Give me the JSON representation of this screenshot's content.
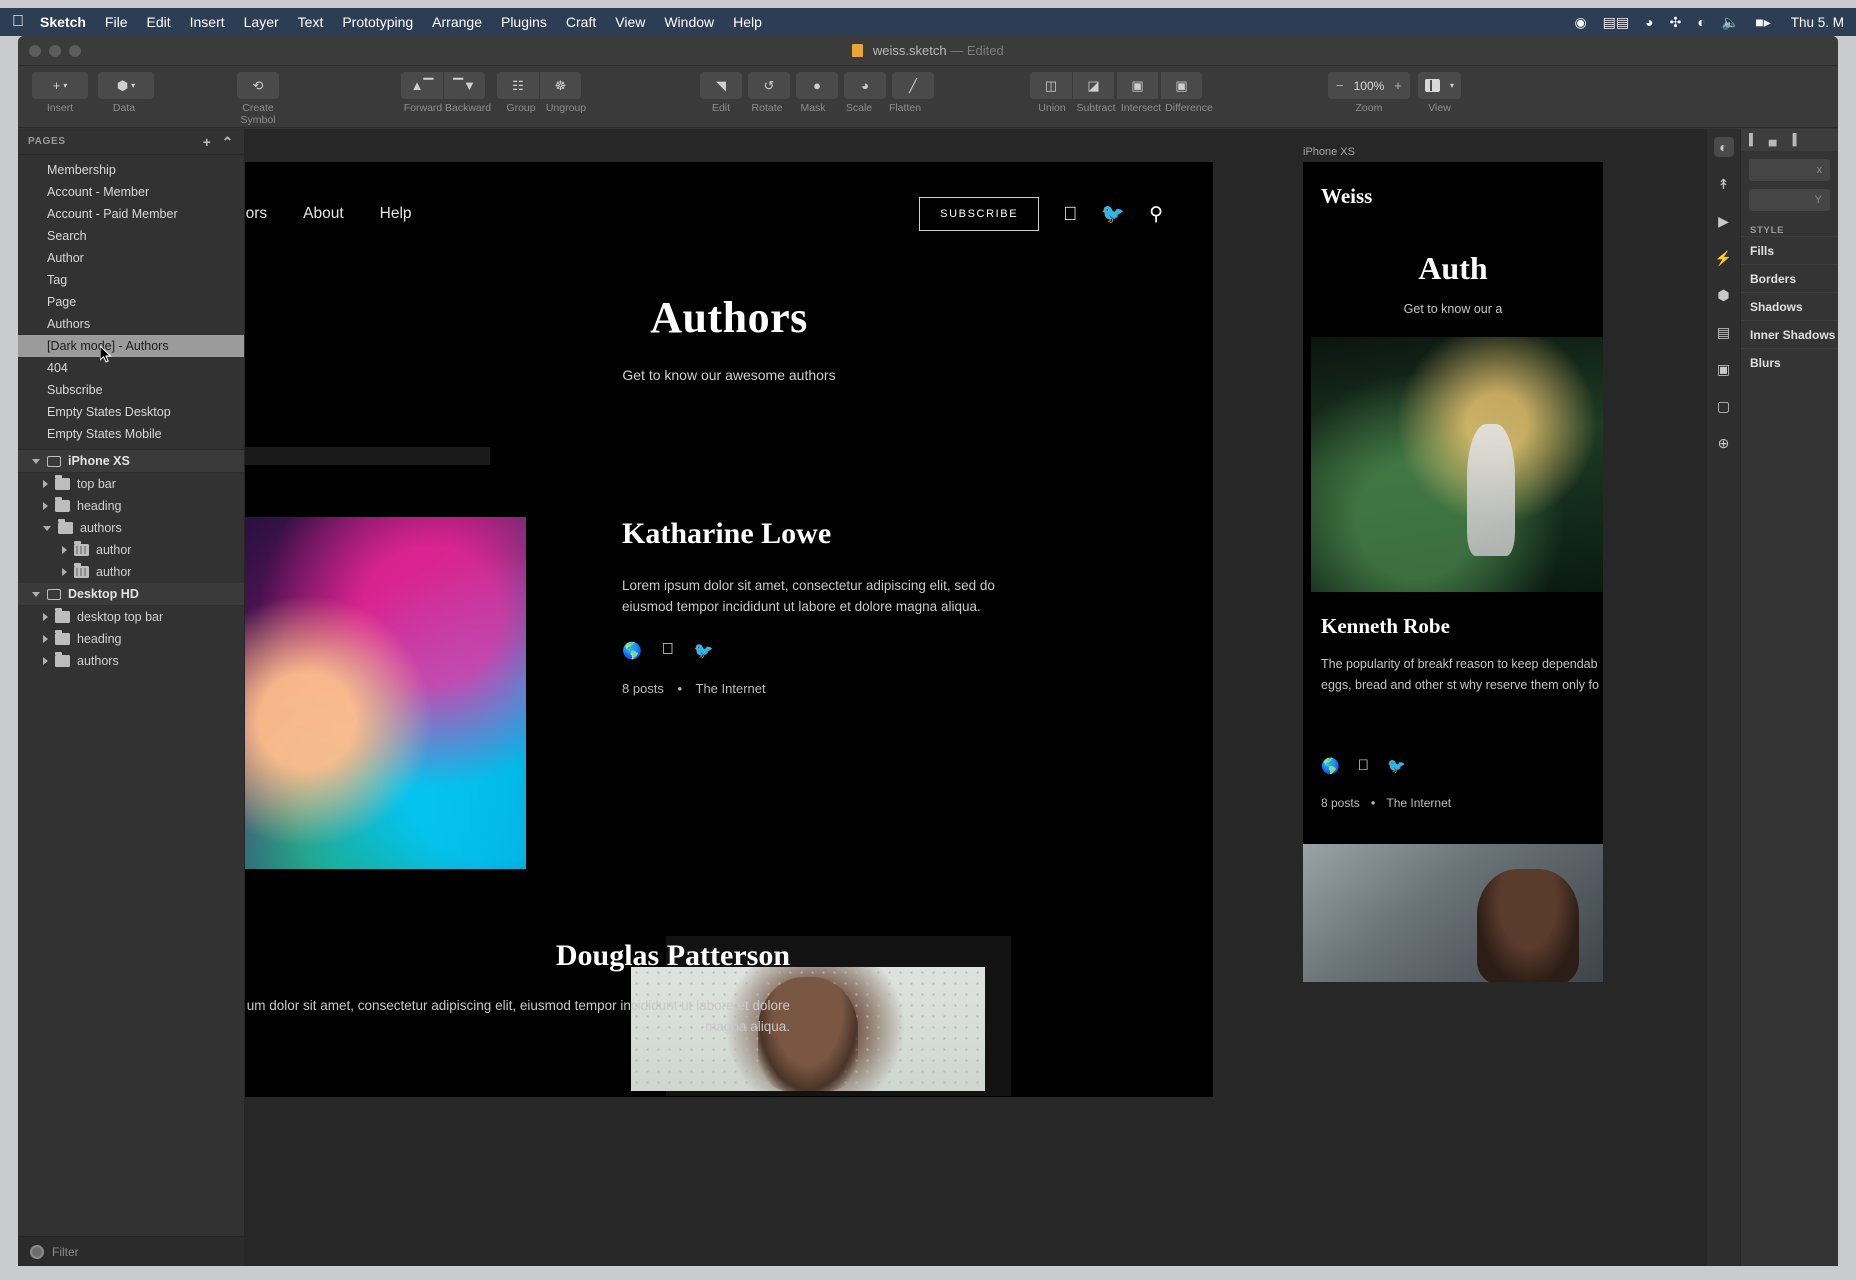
{
  "menubar": {
    "apple_icon": "apple-icon",
    "items": [
      "Sketch",
      "File",
      "Edit",
      "Insert",
      "Layer",
      "Text",
      "Prototyping",
      "Arrange",
      "Plugins",
      "Craft",
      "View",
      "Window",
      "Help"
    ],
    "status_icons": [
      "record-icon",
      "screen-share-icon",
      "clock-icon",
      "dropbox-icon",
      "wifi-icon",
      "volume-icon",
      "battery-icon"
    ],
    "clock": "Thu 5. M"
  },
  "titlebar": {
    "document": "weiss.sketch",
    "state": "— Edited"
  },
  "toolbar": {
    "insert_label": "Insert",
    "data_label": "Data",
    "create_symbol_label": "Create Symbol",
    "forward_label": "Forward",
    "backward_label": "Backward",
    "group_label": "Group",
    "ungroup_label": "Ungroup",
    "edit_label": "Edit",
    "rotate_label": "Rotate",
    "mask_label": "Mask",
    "scale_label": "Scale",
    "flatten_label": "Flatten",
    "union_label": "Union",
    "subtract_label": "Subtract",
    "intersect_label": "Intersect",
    "difference_label": "Difference",
    "zoom_label": "Zoom",
    "zoom_value": "100%",
    "zoom_minus": "−",
    "zoom_plus": "+",
    "view_label": "View"
  },
  "sidebar": {
    "pages_header": "PAGES",
    "add_page": "+",
    "collapse": "⌃",
    "pages": [
      {
        "label": "Membership",
        "selected": false
      },
      {
        "label": "Account - Member",
        "selected": false
      },
      {
        "label": "Account - Paid Member",
        "selected": false
      },
      {
        "label": "Search",
        "selected": false
      },
      {
        "label": "Author",
        "selected": false
      },
      {
        "label": "Tag",
        "selected": false
      },
      {
        "label": "Page",
        "selected": false
      },
      {
        "label": "Authors",
        "selected": false
      },
      {
        "label": "[Dark mode] - Authors",
        "selected": true
      },
      {
        "label": "404",
        "selected": false
      },
      {
        "label": "Subscribe",
        "selected": false
      },
      {
        "label": "Empty States Desktop",
        "selected": false
      },
      {
        "label": "Empty States Mobile",
        "selected": false
      }
    ],
    "artboards": [
      {
        "name": "iPhone XS",
        "layers": [
          {
            "label": "top bar",
            "depth": 1,
            "open": false
          },
          {
            "label": "heading",
            "depth": 1,
            "open": false
          },
          {
            "label": "authors",
            "depth": 1,
            "open": true
          },
          {
            "label": "author",
            "depth": 2,
            "open": false
          },
          {
            "label": "author",
            "depth": 2,
            "open": false
          }
        ]
      },
      {
        "name": "Desktop HD",
        "layers": [
          {
            "label": "desktop top bar",
            "depth": 1,
            "open": false
          },
          {
            "label": "heading",
            "depth": 1,
            "open": false
          },
          {
            "label": "authors",
            "depth": 1,
            "open": false
          }
        ]
      }
    ],
    "filter_placeholder": "Filter"
  },
  "canvas": {
    "desktop_artboard": {
      "nav_links": [
        "hors",
        "About",
        "Help"
      ],
      "subscribe": "SUBSCRIBE",
      "nav_icons": [
        "facebook-icon",
        "twitter-icon",
        "search-icon"
      ],
      "hero_title": "Authors",
      "hero_subtitle": "Get to know our awesome authors",
      "authors": [
        {
          "name": "Katharine Lowe",
          "bio": "Lorem ipsum dolor sit amet, consectetur adipiscing elit, sed do eiusmod tempor incididunt ut labore et dolore magna aliqua.",
          "socials": [
            "globe-icon",
            "facebook-icon",
            "twitter-icon"
          ],
          "posts": "8 posts",
          "separator": "•",
          "location": "The Internet"
        },
        {
          "name": "Douglas Patterson",
          "bio": "um dolor sit amet, consectetur adipiscing elit, eiusmod tempor incididunt ut labore et dolore magna aliqua."
        }
      ]
    },
    "phone_artboard": {
      "label": "iPhone XS",
      "brand": "Weiss",
      "title": "Auth",
      "subtitle": "Get to know our a",
      "author_name": "Kenneth Robe",
      "author_bio": "The popularity of breakf reason to keep dependab eggs, bread and other st why reserve them only fo",
      "socials": [
        "globe-icon",
        "facebook-icon",
        "twitter-icon"
      ],
      "posts": "8 posts",
      "separator": "•",
      "location": "The Internet"
    }
  },
  "inspector": {
    "field_x": "x",
    "field_y": "Y",
    "style_header": "STYLE",
    "rows": [
      "Fills",
      "Borders",
      "Shadows",
      "Inner Shadows",
      "Blurs"
    ],
    "rail_icons": [
      "contrast-icon",
      "export-icon",
      "play-icon",
      "lightning-icon",
      "component-icon",
      "list-icon",
      "layout-icon",
      "image-icon",
      "insert-icon"
    ]
  }
}
